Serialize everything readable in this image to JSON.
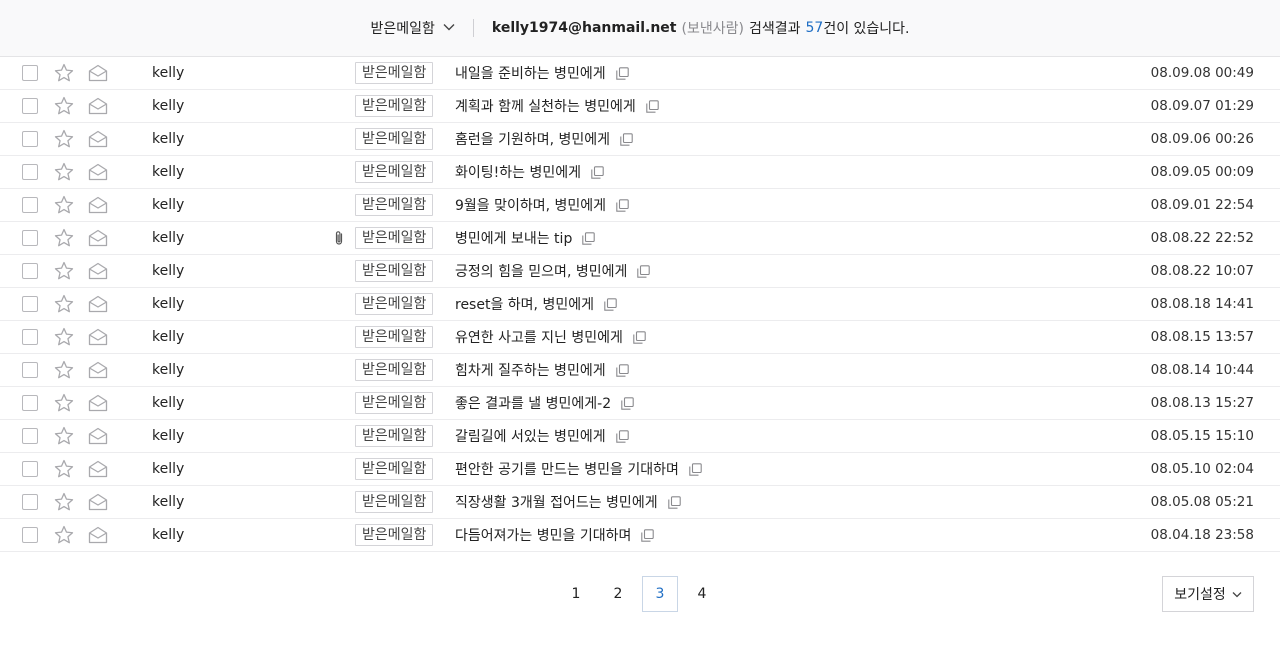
{
  "header": {
    "folder_label": "받은메일함",
    "email": "kelly1974@hanmail.net",
    "role": "(보낸사람)",
    "result_prefix": "검색결과",
    "result_count": "57",
    "result_suffix": "건이 있습니다."
  },
  "messages": [
    {
      "from": "kelly",
      "folder": "받은메일함",
      "subject": "내일을 준비하는 병민에게",
      "date": "08.09.08 00:49",
      "attachment": false
    },
    {
      "from": "kelly",
      "folder": "받은메일함",
      "subject": "계획과 함께 실천하는 병민에게",
      "date": "08.09.07 01:29",
      "attachment": false
    },
    {
      "from": "kelly",
      "folder": "받은메일함",
      "subject": "홈런을 기원하며, 병민에게",
      "date": "08.09.06 00:26",
      "attachment": false
    },
    {
      "from": "kelly",
      "folder": "받은메일함",
      "subject": "화이팅!하는 병민에게",
      "date": "08.09.05 00:09",
      "attachment": false
    },
    {
      "from": "kelly",
      "folder": "받은메일함",
      "subject": "9월을 맞이하며, 병민에게",
      "date": "08.09.01 22:54",
      "attachment": false
    },
    {
      "from": "kelly",
      "folder": "받은메일함",
      "subject": "병민에게 보내는 tip",
      "date": "08.08.22 22:52",
      "attachment": true
    },
    {
      "from": "kelly",
      "folder": "받은메일함",
      "subject": "긍정의 힘을 믿으며, 병민에게",
      "date": "08.08.22 10:07",
      "attachment": false
    },
    {
      "from": "kelly",
      "folder": "받은메일함",
      "subject": "reset을 하며, 병민에게",
      "date": "08.08.18 14:41",
      "attachment": false
    },
    {
      "from": "kelly",
      "folder": "받은메일함",
      "subject": "유연한 사고를 지닌 병민에게",
      "date": "08.08.15 13:57",
      "attachment": false
    },
    {
      "from": "kelly",
      "folder": "받은메일함",
      "subject": "힘차게 질주하는 병민에게",
      "date": "08.08.14 10:44",
      "attachment": false
    },
    {
      "from": "kelly",
      "folder": "받은메일함",
      "subject": "좋은 결과를 낼 병민에게-2",
      "date": "08.08.13 15:27",
      "attachment": false
    },
    {
      "from": "kelly",
      "folder": "받은메일함",
      "subject": "갈림길에 서있는 병민에게",
      "date": "08.05.15 15:10",
      "attachment": false
    },
    {
      "from": "kelly",
      "folder": "받은메일함",
      "subject": "편안한 공기를 만드는 병민을 기대하며",
      "date": "08.05.10 02:04",
      "attachment": false
    },
    {
      "from": "kelly",
      "folder": "받은메일함",
      "subject": "직장생활 3개월 접어드는 병민에게",
      "date": "08.05.08 05:21",
      "attachment": false
    },
    {
      "from": "kelly",
      "folder": "받은메일함",
      "subject": "다듬어져가는 병민을 기대하며",
      "date": "08.04.18 23:58",
      "attachment": false
    }
  ],
  "pagination": {
    "pages": [
      "1",
      "2",
      "3",
      "4"
    ],
    "current": "3"
  },
  "view_settings_label": "보기설정",
  "colors": {
    "accent": "#1f6ec4",
    "header_bg": "#f9f9fa",
    "border": "#ececee"
  }
}
